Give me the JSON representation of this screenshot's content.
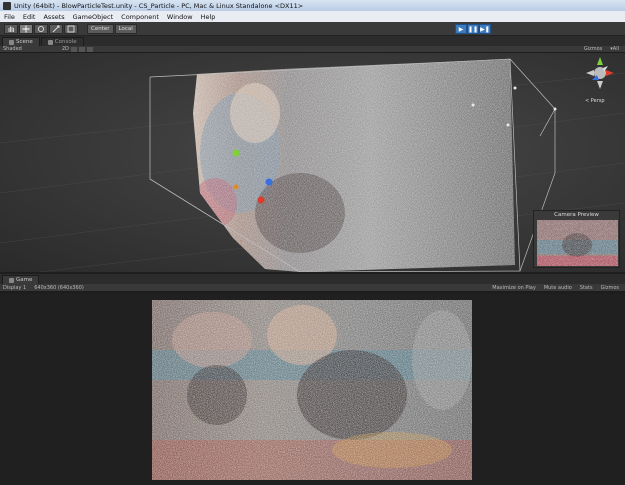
{
  "window": {
    "title": "Unity (64bit) - BlowParticleTest.unity - CS_Particle - PC, Mac & Linux Standalone <DX11>"
  },
  "menu": [
    "File",
    "Edit",
    "Assets",
    "GameObject",
    "Component",
    "Window",
    "Help"
  ],
  "toolbar": {
    "tools": [
      "hand-tool",
      "move-tool",
      "rotate-tool",
      "scale-tool",
      "rect-tool"
    ],
    "pivot_label": "Center",
    "space_label": "Local",
    "play_glyph": "▶",
    "pause_glyph": "❚❚",
    "step_glyph": "▶❚"
  },
  "scene_panel": {
    "tabs": [
      "Scene",
      "Console"
    ],
    "shading_mode": "Shaded",
    "mode_2d": "2D",
    "gizmos_label": "Gizmos",
    "search_hint": "▾All",
    "perspective_label": "< Persp",
    "camera_preview_title": "Camera Preview"
  },
  "game_panel": {
    "tab": "Game",
    "display": "Display 1",
    "resolution": "640x360 (640x360)",
    "maximize_on_play": "Maximize on Play",
    "mute_audio": "Mute audio",
    "stats": "Stats",
    "gizmos": "Gizmos"
  },
  "colors": {
    "accent_play": "#3d7bbf",
    "editor_bg": "#3b3b3b"
  }
}
